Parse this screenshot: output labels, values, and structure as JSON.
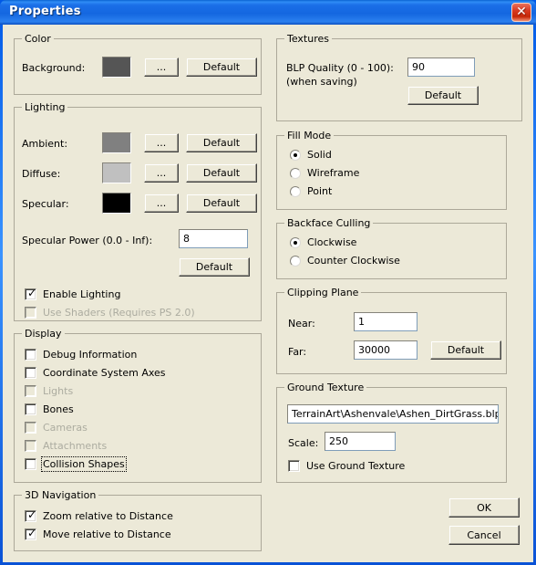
{
  "window": {
    "title": "Properties",
    "close_icon": "close-icon",
    "close_label": "✕"
  },
  "colors": {
    "titlebar_blue": "#1467e0",
    "client_bg": "#ece9d8",
    "group_border": "#aca899",
    "disabled_text": "#acaca0",
    "close_red": "#c62808"
  },
  "color_group": {
    "legend": "Color",
    "background_label": "Background:",
    "background_swatch": "#555555",
    "browse_label": "...",
    "default_label": "Default"
  },
  "lighting_group": {
    "legend": "Lighting",
    "rows": [
      {
        "label": "Ambient:",
        "swatch": "#808080",
        "browse_label": "...",
        "default_label": "Default"
      },
      {
        "label": "Diffuse:",
        "swatch": "#c0c0c0",
        "browse_label": "...",
        "default_label": "Default"
      },
      {
        "label": "Specular:",
        "swatch": "#000000",
        "browse_label": "...",
        "default_label": "Default"
      }
    ],
    "specular_power_label": "Specular Power (0.0 - Inf):",
    "specular_power_value": "8",
    "specular_power_default_label": "Default",
    "checkboxes": [
      {
        "label": "Enable Lighting",
        "checked": true,
        "disabled": false,
        "focus": false
      },
      {
        "label": "Use Shaders (Requires PS 2.0)",
        "checked": false,
        "disabled": true,
        "focus": false
      }
    ]
  },
  "display_group": {
    "legend": "Display",
    "checkboxes": [
      {
        "label": "Debug Information",
        "checked": false,
        "disabled": false,
        "focus": false
      },
      {
        "label": "Coordinate System Axes",
        "checked": false,
        "disabled": false,
        "focus": false
      },
      {
        "label": "Lights",
        "checked": false,
        "disabled": true,
        "focus": false
      },
      {
        "label": "Bones",
        "checked": false,
        "disabled": false,
        "focus": false
      },
      {
        "label": "Cameras",
        "checked": false,
        "disabled": true,
        "focus": false
      },
      {
        "label": "Attachments",
        "checked": false,
        "disabled": true,
        "focus": false
      },
      {
        "label": "Collision Shapes",
        "checked": false,
        "disabled": false,
        "focus": true
      }
    ]
  },
  "navigation_group": {
    "legend": "3D Navigation",
    "checkboxes": [
      {
        "label": "Zoom relative to Distance",
        "checked": true,
        "disabled": false,
        "focus": false
      },
      {
        "label": "Move relative to Distance",
        "checked": true,
        "disabled": false,
        "focus": false
      }
    ]
  },
  "textures_group": {
    "legend": "Textures",
    "quality_label_line1": "BLP Quality (0 - 100):",
    "quality_label_line2": "(when saving)",
    "quality_value": "90",
    "default_label": "Default"
  },
  "fill_mode_group": {
    "legend": "Fill Mode",
    "options": [
      {
        "label": "Solid",
        "selected": true
      },
      {
        "label": "Wireframe",
        "selected": false
      },
      {
        "label": "Point",
        "selected": false
      }
    ]
  },
  "backface_group": {
    "legend": "Backface Culling",
    "options": [
      {
        "label": "Clockwise",
        "selected": true
      },
      {
        "label": "Counter Clockwise",
        "selected": false
      }
    ]
  },
  "clipping_group": {
    "legend": "Clipping Plane",
    "near_label": "Near:",
    "near_value": "1",
    "far_label": "Far:",
    "far_value": "30000",
    "default_label": "Default"
  },
  "ground_texture_group": {
    "legend": "Ground Texture",
    "path_value": "TerrainArt\\Ashenvale\\Ashen_DirtGrass.blp",
    "scale_label": "Scale:",
    "scale_value": "250",
    "use_ground_texture": {
      "label": "Use Ground Texture",
      "checked": false,
      "disabled": false,
      "focus": false
    }
  },
  "footer": {
    "ok_label": "OK",
    "cancel_label": "Cancel"
  }
}
